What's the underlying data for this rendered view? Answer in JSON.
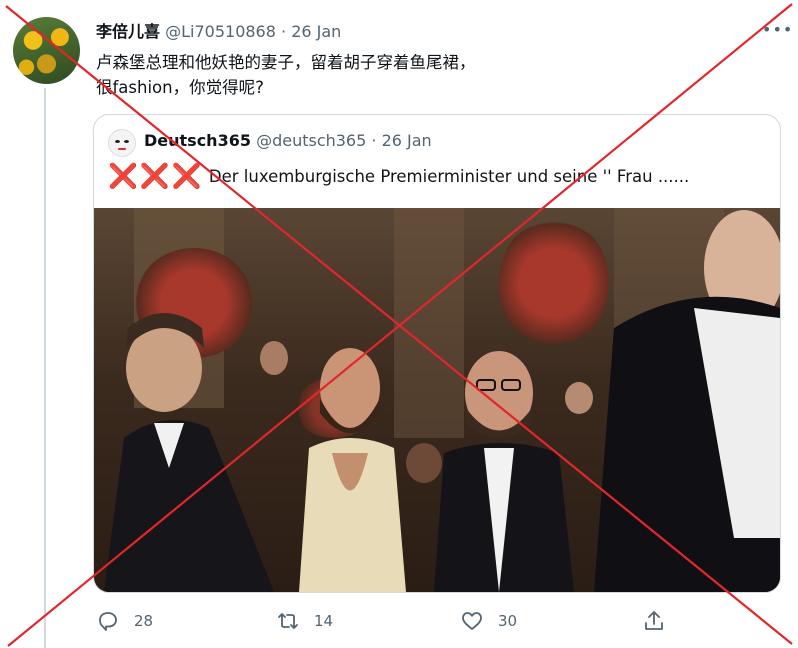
{
  "tweet": {
    "display_name": "李倍儿喜",
    "handle": "@Li70510868",
    "separator": "·",
    "date": "26 Jan",
    "more_label": "•••",
    "text_line1": "卢森堡总理和他妖艳的妻子，留着胡子穿着鱼尾裙，",
    "text_line2": "很fashion，你觉得呢?"
  },
  "quote": {
    "display_name": "Deutsch365",
    "handle": "@deutsch365",
    "separator": "·",
    "date": "26 Jan",
    "marks": "❌❌❌",
    "text": " Der luxemburgische Premierminister und seine '' Frau ......"
  },
  "actions": {
    "reply_count": "28",
    "retweet_count": "14",
    "like_count": "30"
  },
  "icons": {
    "reply": "reply-icon",
    "retweet": "retweet-icon",
    "like": "heart-icon",
    "share": "share-icon",
    "more": "more-icon"
  },
  "colors": {
    "text_primary": "#0f1419",
    "text_secondary": "#536471",
    "cross": "#e3262b",
    "x_mark": "#dd2e44"
  }
}
